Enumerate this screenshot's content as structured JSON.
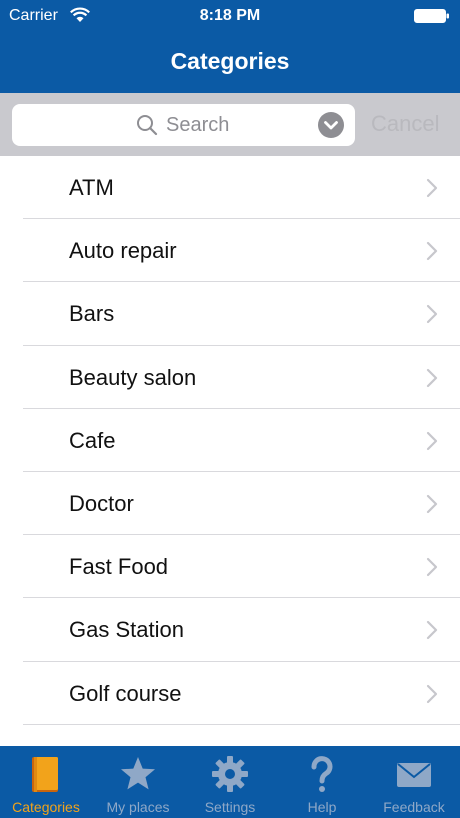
{
  "status_bar": {
    "carrier": "Carrier",
    "time": "8:18 PM",
    "wifi_icon": "wifi-icon",
    "battery_icon": "battery-icon"
  },
  "nav": {
    "title": "Categories"
  },
  "search": {
    "placeholder": "Search",
    "cancel_label": "Cancel",
    "search_icon": "magnifier-icon",
    "dropdown_icon": "chevron-down-circle-icon"
  },
  "categories": [
    {
      "label": "ATM"
    },
    {
      "label": "Auto repair"
    },
    {
      "label": "Bars"
    },
    {
      "label": "Beauty salon"
    },
    {
      "label": "Cafe"
    },
    {
      "label": "Doctor"
    },
    {
      "label": "Fast Food"
    },
    {
      "label": "Gas Station"
    },
    {
      "label": "Golf course"
    }
  ],
  "tab_bar": {
    "tabs": [
      {
        "label": "Categories",
        "icon": "book-icon",
        "active": true
      },
      {
        "label": "My places",
        "icon": "star-icon",
        "active": false
      },
      {
        "label": "Settings",
        "icon": "gear-icon",
        "active": false
      },
      {
        "label": "Help",
        "icon": "question-icon",
        "active": false
      },
      {
        "label": "Feedback",
        "icon": "envelope-icon",
        "active": false
      }
    ]
  },
  "colors": {
    "bar_blue": "#0b5aa5",
    "active_tab": "#f2a31b",
    "inactive_tab": "#8fa8c7",
    "search_bg": "#c9c9ce"
  }
}
